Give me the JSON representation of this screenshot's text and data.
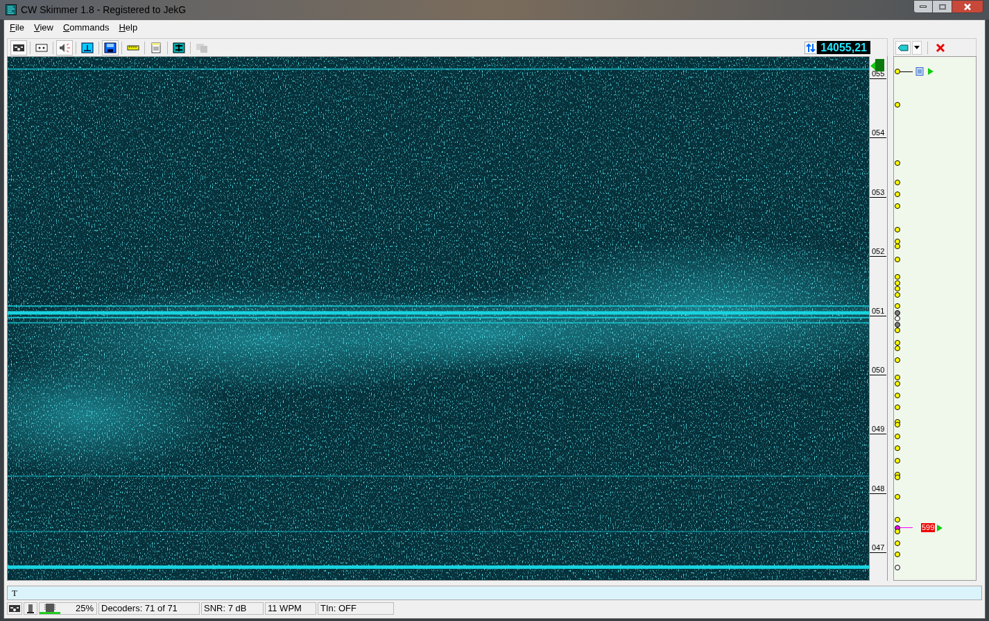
{
  "window": {
    "title": "CW Skimmer 1.8 - Registered to JekG"
  },
  "menu": [
    {
      "label": "File"
    },
    {
      "label": "View"
    },
    {
      "label": "Commands"
    },
    {
      "label": "Help"
    }
  ],
  "toolbar": [
    {
      "kind": "radio",
      "pressed": true
    },
    {
      "kind": "tape",
      "pressed": false
    },
    {
      "kind": "speaker",
      "pressed": true
    },
    {
      "kind": "tune",
      "pressed": false
    },
    {
      "kind": "save",
      "pressed": true
    },
    {
      "kind": "ruler",
      "pressed": false
    },
    {
      "kind": "notes",
      "pressed": false
    },
    {
      "kind": "filter",
      "pressed": false
    },
    {
      "kind": "windows",
      "pressed": false,
      "disabled": true
    }
  ],
  "frequency": "14055,21",
  "scale": [
    "055",
    "054",
    "053",
    "052",
    "051",
    "050",
    "049",
    "048",
    "047"
  ],
  "spots": [
    {
      "kind": "call",
      "color": "#ffff00"
    },
    {
      "kind": "dot",
      "color": "#ffff00"
    },
    {
      "kind": "dot",
      "color": "#ffff00"
    },
    {
      "kind": "dot",
      "color": "#ffff00"
    },
    {
      "kind": "dot",
      "color": "#ffff00"
    },
    {
      "kind": "dot",
      "color": "#ffff00"
    },
    {
      "kind": "dot",
      "color": "#ffff00"
    },
    {
      "kind": "dot",
      "color": "#ffff00"
    },
    {
      "kind": "dot",
      "color": "#ffff00"
    },
    {
      "kind": "dot",
      "color": "#ffff00"
    },
    {
      "kind": "dot",
      "color": "#ffff00"
    },
    {
      "kind": "dot",
      "color": "#ffff00"
    },
    {
      "kind": "dot",
      "color": "#ffff00"
    },
    {
      "kind": "dot",
      "color": "#ffff00"
    },
    {
      "kind": "dot",
      "color": "#ffff00"
    },
    {
      "kind": "dot",
      "color": "#808080"
    },
    {
      "kind": "dot",
      "color": "#ffffff"
    },
    {
      "kind": "dot",
      "color": "#808080"
    },
    {
      "kind": "dot",
      "color": "#ffff00"
    },
    {
      "kind": "dot",
      "color": "#ffff00"
    },
    {
      "kind": "dot",
      "color": "#ffff00"
    },
    {
      "kind": "dot",
      "color": "#ffff00"
    },
    {
      "kind": "dot",
      "color": "#ffff00"
    },
    {
      "kind": "dot",
      "color": "#ffff00"
    },
    {
      "kind": "dot",
      "color": "#ffff00"
    },
    {
      "kind": "dot",
      "color": "#ffff00"
    },
    {
      "kind": "dot",
      "color": "#ffff00"
    },
    {
      "kind": "dot",
      "color": "#ffff00"
    },
    {
      "kind": "dot",
      "color": "#ffff00"
    },
    {
      "kind": "dot",
      "color": "#ffff00"
    },
    {
      "kind": "dot",
      "color": "#ffff00"
    },
    {
      "kind": "dot",
      "color": "#ffff00"
    },
    {
      "kind": "dot",
      "color": "#ffff00"
    },
    {
      "kind": "dot",
      "color": "#ffff00"
    },
    {
      "kind": "dot",
      "color": "#ffff00"
    },
    {
      "kind": "report",
      "color": "#ff00ff",
      "text": "599"
    },
    {
      "kind": "dot",
      "color": "#ffff00"
    },
    {
      "kind": "dot",
      "color": "#ffff00"
    },
    {
      "kind": "dot",
      "color": "#ffff00"
    },
    {
      "kind": "dot",
      "color": "#ffffff"
    }
  ],
  "input": {
    "value": "T"
  },
  "status": {
    "cpu": "25%",
    "fields": [
      "Decoders: 71 of 71",
      "SNR: 7 dB",
      "11 WPM",
      "TIn: OFF"
    ]
  }
}
